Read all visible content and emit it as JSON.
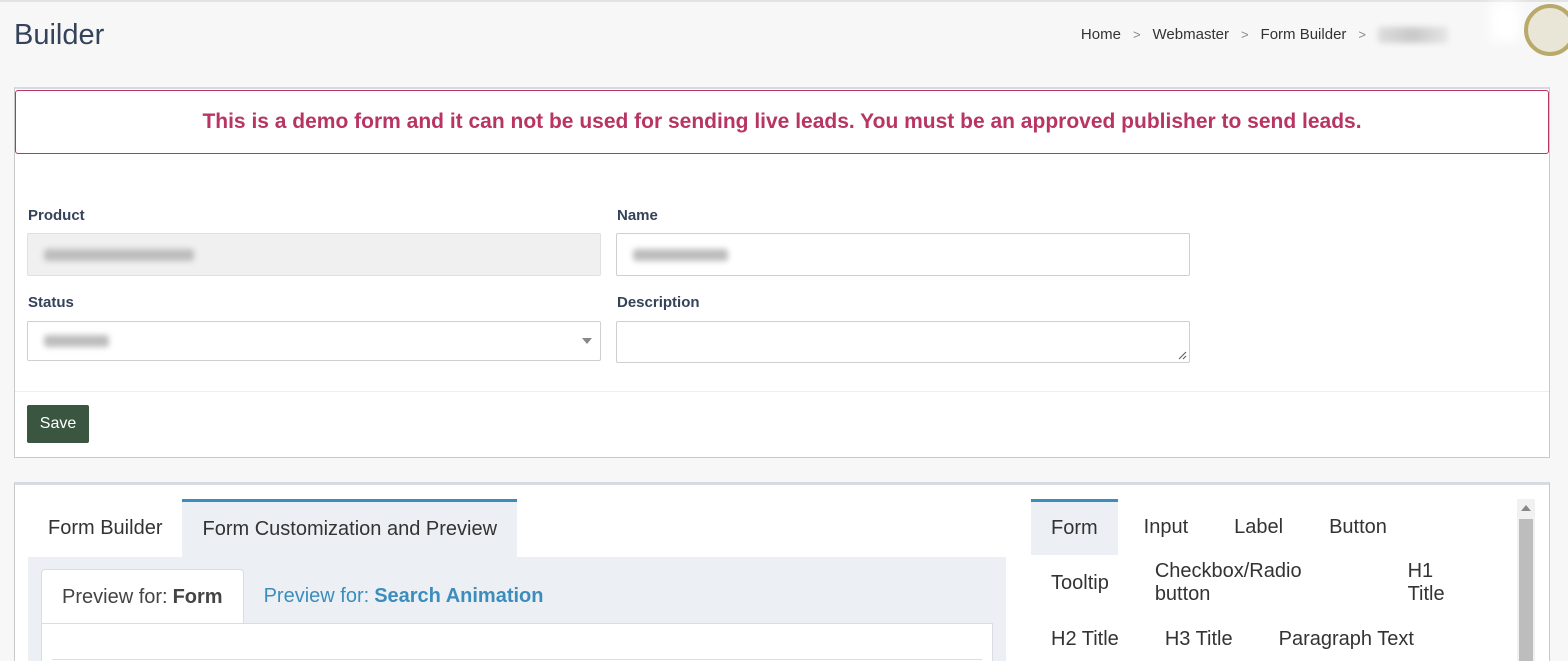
{
  "header": {
    "title": "Builder",
    "breadcrumb": [
      "Home",
      "Webmaster",
      "Form Builder"
    ],
    "separator": ">"
  },
  "alert": {
    "message": "This is a demo form and it can not be used for sending live leads. You must be an approved publisher to send leads."
  },
  "form": {
    "product_label": "Product",
    "name_label": "Name",
    "status_label": "Status",
    "description_label": "Description",
    "description_value": "",
    "save_label": "Save"
  },
  "main_tabs": [
    {
      "label": "Form Builder",
      "active": false
    },
    {
      "label": "Form Customization and Preview",
      "active": true
    }
  ],
  "preview_tabs": [
    {
      "prefix": "Preview for:",
      "target": "Form",
      "active": true
    },
    {
      "prefix": "Preview for:",
      "target": "Search Animation",
      "active": false
    }
  ],
  "style_tabs": {
    "row1": [
      "Form",
      "Input",
      "Label",
      "Button"
    ],
    "row2": [
      "Tooltip",
      "Checkbox/Radio button",
      "H1 Title"
    ],
    "row3": [
      "H2 Title",
      "H3 Title",
      "Paragraph Text"
    ]
  },
  "colors": {
    "alert": "#b83563",
    "title": "#34435a",
    "save_button": "#3a5640",
    "tab_accent": "#3c8dbc"
  }
}
